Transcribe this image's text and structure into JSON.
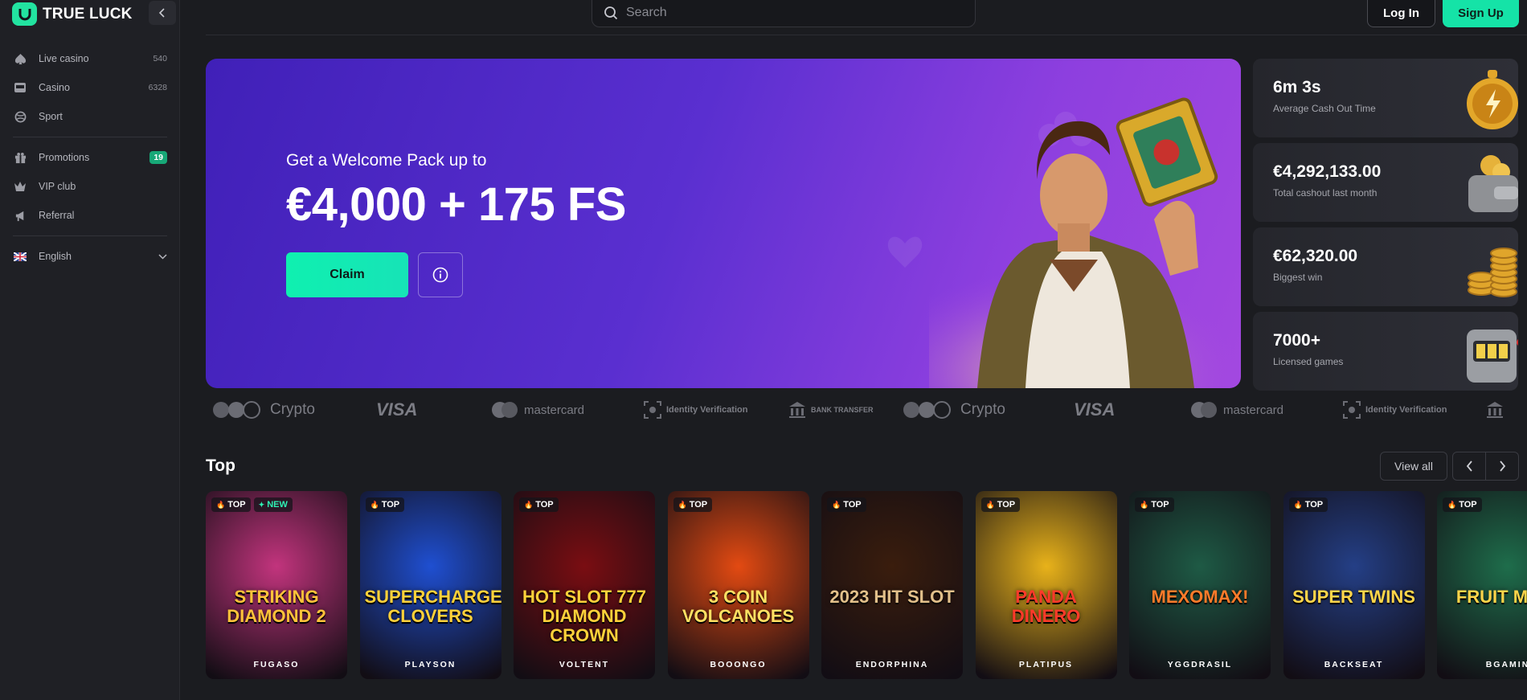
{
  "brand": {
    "name": "TRUE LUCK"
  },
  "sidebar": {
    "items": [
      {
        "label": "Live casino",
        "count": "540",
        "icon": "spade-icon"
      },
      {
        "label": "Casino",
        "count": "6328",
        "icon": "slot-machine-icon"
      },
      {
        "label": "Sport",
        "count": "",
        "icon": "ball-icon"
      },
      {
        "label": "Promotions",
        "badge": "19",
        "icon": "gift-icon"
      },
      {
        "label": "VIP club",
        "icon": "crown-icon"
      },
      {
        "label": "Referral",
        "icon": "megaphone-icon"
      }
    ],
    "language": "English"
  },
  "header": {
    "search_placeholder": "Search",
    "login_label": "Log In",
    "signup_label": "Sign Up"
  },
  "hero": {
    "subtitle": "Get a Welcome Pack up to",
    "title": "€4,000 + 175 FS",
    "claim_label": "Claim"
  },
  "stats": [
    {
      "value": "6m 3s",
      "label": "Average Cash Out Time",
      "icon": "stopwatch-icon"
    },
    {
      "value": "€4,292,133.00",
      "label": "Total cashout last month",
      "icon": "wallet-icon"
    },
    {
      "value": "€62,320.00",
      "label": "Biggest win",
      "icon": "coins-icon"
    },
    {
      "value": "7000+",
      "label": "Licensed games",
      "icon": "slot-machine-icon"
    }
  ],
  "payments": [
    "Crypto",
    "VISA",
    "mastercard",
    "Identity Verification",
    "BANK TRANSFER",
    "Crypto",
    "VISA",
    "mastercard",
    "Identity Verification"
  ],
  "top_section": {
    "title": "Top",
    "view_all_label": "View all"
  },
  "games": [
    {
      "name": "STRIKING DIAMOND 2",
      "provider": "FUGASO",
      "tags": [
        "TOP",
        "NEW"
      ],
      "color": "#c2347d"
    },
    {
      "name": "SUPERCHARGED CLOVERS",
      "provider": "PLAYSON",
      "tags": [
        "TOP"
      ],
      "color": "#1f4fd1"
    },
    {
      "name": "HOT SLOT 777 DIAMOND CROWN",
      "provider": "VOLTENT",
      "tags": [
        "TOP"
      ],
      "color": "#7a0d12"
    },
    {
      "name": "3 COIN VOLCANOES",
      "provider": "BOOONGO",
      "tags": [
        "TOP"
      ],
      "color": "#e34a12"
    },
    {
      "name": "2023 HIT SLOT",
      "provider": "ENDORPHINA",
      "tags": [
        "TOP"
      ],
      "color": "#3a1d0d"
    },
    {
      "name": "PANDA DINERO",
      "provider": "PLATIPUS",
      "tags": [
        "TOP"
      ],
      "color": "#e8b21a"
    },
    {
      "name": "MEXOMAX!",
      "provider": "YGGDRASIL",
      "tags": [
        "TOP"
      ],
      "color": "#1e5a45"
    },
    {
      "name": "SUPER TWINS",
      "provider": "BACKSEAT",
      "tags": [
        "TOP"
      ],
      "color": "#243f86"
    },
    {
      "name": "FRUIT MILLI",
      "provider": "BGAMIN",
      "tags": [
        "TOP"
      ],
      "color": "#1e6d4b"
    }
  ]
}
